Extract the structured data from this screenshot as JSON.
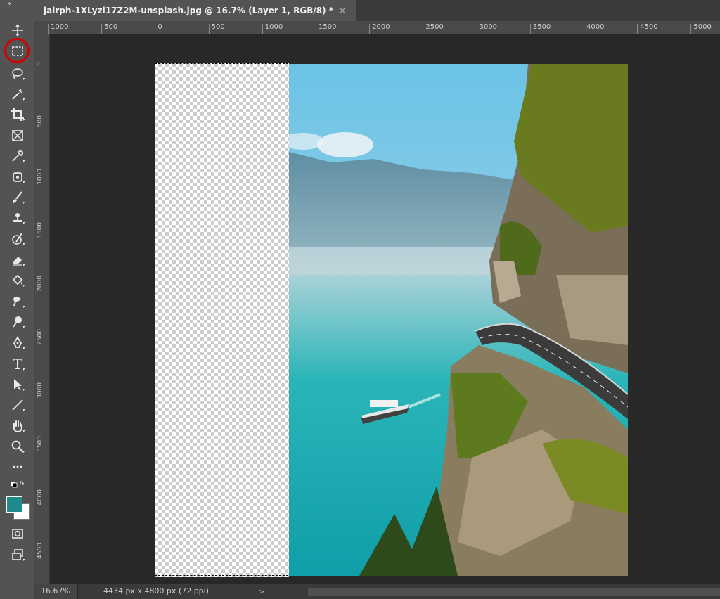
{
  "tab": {
    "title": "jairph-1XLyzi17Z2M-unsplash.jpg @ 16.7% (Layer 1, RGB/8) *",
    "close": "×"
  },
  "toolbar": {
    "collapse": "»",
    "tools": [
      "move-tool",
      "rectangular-marquee-tool",
      "lasso-tool",
      "magic-wand-tool",
      "crop-tool",
      "frame-tool",
      "eyedropper-tool",
      "spot-healing-tool",
      "brush-tool",
      "clone-stamp-tool",
      "history-brush-tool",
      "eraser-tool",
      "paint-bucket-tool",
      "blur-tool",
      "dodge-tool",
      "pen-tool",
      "type-tool",
      "path-selection-tool",
      "line-tool",
      "hand-tool",
      "zoom-tool",
      "edit-toolbar",
      "default-colors",
      "quick-mask",
      "screen-mode"
    ],
    "type_tool_glyph": "T",
    "more_glyph": "···",
    "foreground_color": "#1f8a8c",
    "background_color": "#ffffff"
  },
  "ruler": {
    "top_labels": [
      "1000",
      "500",
      "0",
      "500",
      "1000",
      "1500",
      "2000",
      "2500",
      "3000",
      "3500",
      "4000",
      "4500",
      "5000"
    ],
    "left_labels": [
      "0",
      "500",
      "1000",
      "1500",
      "2000",
      "2500",
      "3000",
      "3500",
      "4000",
      "4500"
    ]
  },
  "status": {
    "zoom": "16.67%",
    "doc_size": "4434 px x 4800 px (72 ppi)",
    "arrow": ">"
  },
  "colors": {
    "highlight": "#d40000",
    "water": "#1aa6a8",
    "sky": "#7cc8e4"
  }
}
